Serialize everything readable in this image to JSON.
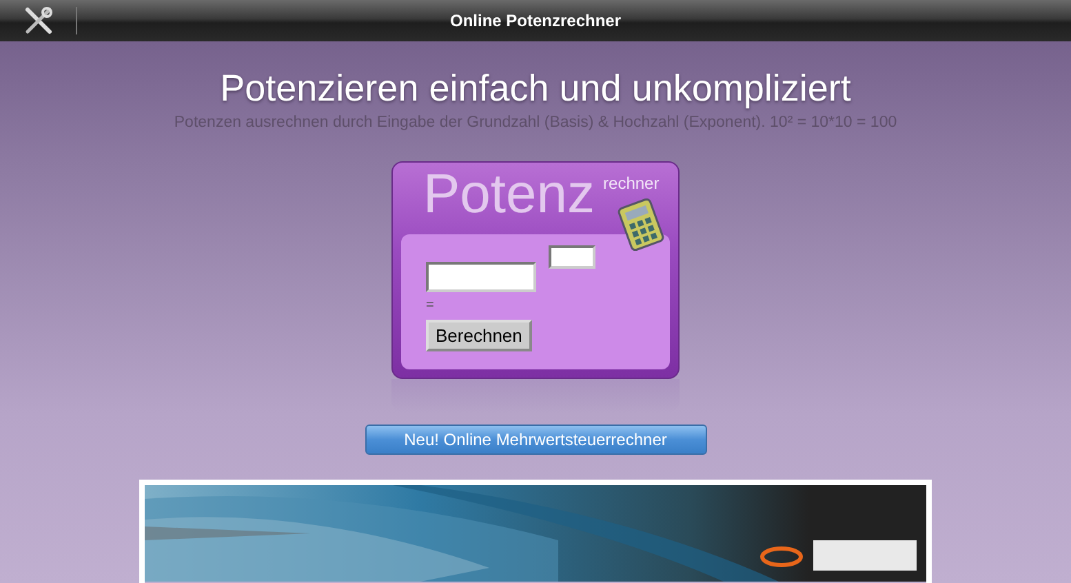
{
  "top_bar": {
    "title": "Online Potenzrechner"
  },
  "heading": "Potenzieren einfach und unkompliziert",
  "subtitle": "Potenzen ausrechnen durch Eingabe der Grundzahl (Basis) & Hochzahl (Exponent). 10² = 10*10 = 100",
  "calculator": {
    "logo_main": "Potenz",
    "logo_sup": "rechner",
    "result": "=",
    "button": "Berechnen"
  },
  "promo_button": "Neu! Online Mehrwertsteuerrechner"
}
